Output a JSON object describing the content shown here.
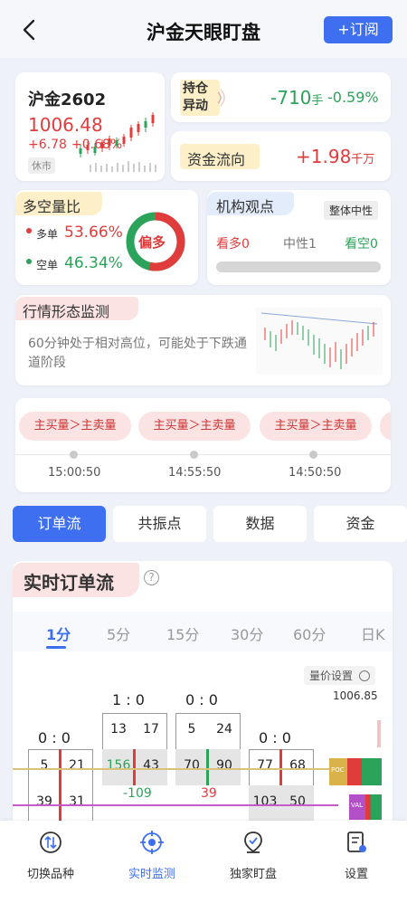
{
  "header": {
    "title": "沪金天眼盯盘",
    "subscribe_label": "+订阅"
  },
  "quote": {
    "symbol": "沪金2602",
    "price": "1006.48",
    "change": "+6.78",
    "change_pct": "+0.68%",
    "status": "休市"
  },
  "position": {
    "label": "持仓异动",
    "label_line1": "持仓",
    "label_line2": "异动",
    "value": "-710",
    "unit": "手",
    "pct": "-0.59%"
  },
  "fund_flow": {
    "label": "资金流向",
    "value": "+1.98",
    "unit": "千万"
  },
  "long_short": {
    "label": "多空量比",
    "long_label": "多单",
    "long_pct": "53.66%",
    "short_label": "空单",
    "short_pct": "46.34%",
    "bias": "偏多",
    "long_fraction": 0.5366
  },
  "institution": {
    "label": "机构观点",
    "overall": "整体中性",
    "bull": "看多0",
    "neutral": "中性1",
    "bear": "看空0"
  },
  "pattern": {
    "label": "行情形态监测",
    "description": "60分钟处于相对高位，可能处于下跌通道阶段"
  },
  "timeline": {
    "items": [
      {
        "chip": "主买量＞主卖量",
        "time": "15:00:50"
      },
      {
        "chip": "主买量＞主卖量",
        "time": "14:55:50"
      },
      {
        "chip": "主买量＞主卖量",
        "time": "14:50:50"
      }
    ]
  },
  "tabs": [
    "订单流",
    "共振点",
    "数据",
    "资金"
  ],
  "order_flow": {
    "title": "实时订单流",
    "help_icon": "question-circle-icon",
    "periods": [
      "1分",
      "5分",
      "15分",
      "30分",
      "60分",
      "日K"
    ],
    "price_settings": "量价设置",
    "price_level": "1006.85",
    "bars": [
      {
        "ratio": "0 : 0",
        "rows": [
          [
            "5",
            "21"
          ],
          [
            "39",
            "31"
          ]
        ]
      },
      {
        "ratio": "1 : 0",
        "rows": [
          [
            "13",
            "17"
          ],
          [
            "156",
            "43"
          ]
        ]
      },
      {
        "ratio": "0 : 0",
        "rows": [
          [
            "5",
            "24"
          ],
          [
            "70",
            "90"
          ]
        ]
      },
      {
        "ratio": "0 : 0",
        "rows": [
          [
            "77",
            "68"
          ],
          [
            "103",
            "50"
          ]
        ]
      }
    ],
    "delta_neg": "-109",
    "delta_pos": "39",
    "poc_label": "POC",
    "val_label": "VAL"
  },
  "bottom_nav": [
    {
      "label": "切换品种",
      "icon": "swap-icon"
    },
    {
      "label": "实时监测",
      "icon": "target-icon"
    },
    {
      "label": "独家盯盘",
      "icon": "location-icon"
    },
    {
      "label": "设置",
      "icon": "settings-doc-icon"
    }
  ],
  "colors": {
    "accent": "#3e6ff0",
    "up": "#e03c3c",
    "down": "#2ca35a"
  }
}
